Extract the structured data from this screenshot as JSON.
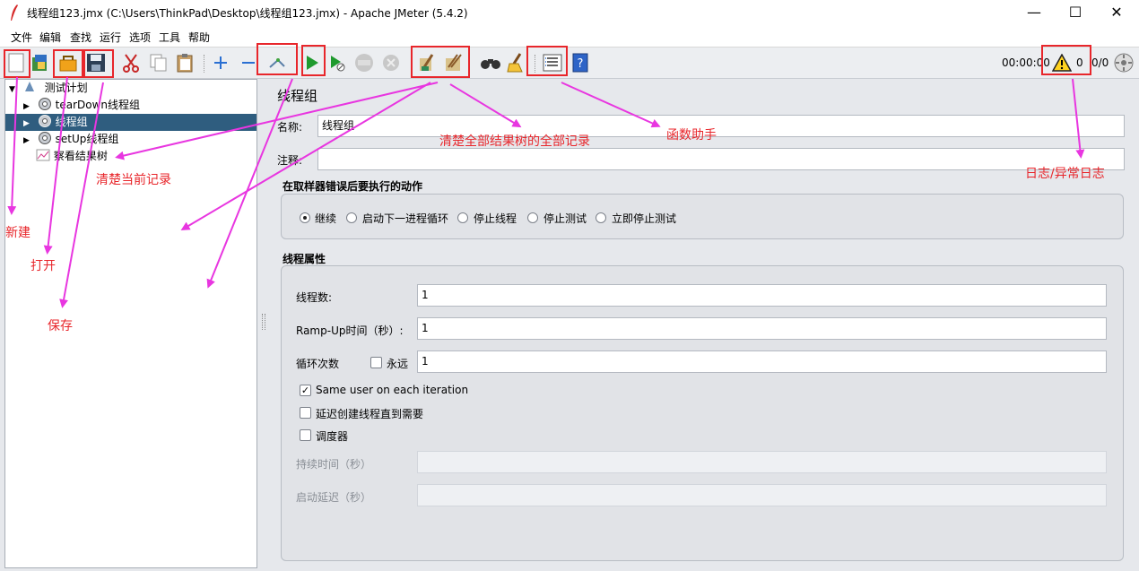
{
  "window": {
    "title": "线程组123.jmx (C:\\Users\\ThinkPad\\Desktop\\线程组123.jmx) - Apache JMeter (5.4.2)",
    "minimize": "—",
    "maximize": "☐",
    "close": "✕"
  },
  "menu": [
    "文件",
    "编辑",
    "查找",
    "运行",
    "选项",
    "工具",
    "帮助"
  ],
  "toolbar": {
    "elapsed": "00:00:00",
    "warning_count": "0",
    "thread_count": "0/0",
    "icons": [
      "new-icon",
      "templates-icon",
      "open-icon",
      "save-icon",
      "cut-icon",
      "copy-icon",
      "paste-icon",
      "expand-icon",
      "collapse-icon",
      "toggle-icon",
      "start-icon",
      "start-no-pause-icon",
      "stop-icon",
      "shutdown-icon",
      "clear-icon",
      "clear-all-icon",
      "search-icon",
      "reset-search-icon",
      "function-helper-icon",
      "help-icon",
      "warning-icon",
      "remote-icon"
    ]
  },
  "tree": {
    "items": [
      {
        "label": "测试计划"
      },
      {
        "label": "tearDown线程组"
      },
      {
        "label": "线程组"
      },
      {
        "label": "setUp线程组"
      },
      {
        "label": "察看结果树"
      }
    ]
  },
  "panel": {
    "title": "线程组",
    "name_label": "名称:",
    "name_value": "线程组",
    "comment_label": "注释:",
    "comment_value": "",
    "sampler_error_group": "在取样器错误后要执行的动作",
    "error_actions": [
      "继续",
      "启动下一进程循环",
      "停止线程",
      "停止测试",
      "立即停止测试"
    ],
    "selected_error_action": "继续",
    "thread_props_group": "线程属性",
    "threads_label": "线程数:",
    "threads_value": "1",
    "rampup_label": "Ramp-Up时间（秒）:",
    "rampup_value": "1",
    "loop_label": "循环次数",
    "forever_label": "永远",
    "loop_value": "1",
    "same_user_label": "Same user on each iteration",
    "same_user_checked": true,
    "delay_label": "延迟创建线程直到需要",
    "scheduler_label": "调度器",
    "duration_label": "持续时间（秒）",
    "startup_delay_label": "启动延迟（秒）"
  },
  "annotations": {
    "new": "新建",
    "open": "打开",
    "save": "保存",
    "clear_current": "清楚当前记录",
    "clear_all": "清楚全部结果树的全部记录",
    "function_helper": "函数助手",
    "log": "日志/异常日志"
  },
  "colors": {
    "annotation": "#e8262b",
    "arrow": "#e836e0",
    "selection": "#2f5d7f"
  }
}
